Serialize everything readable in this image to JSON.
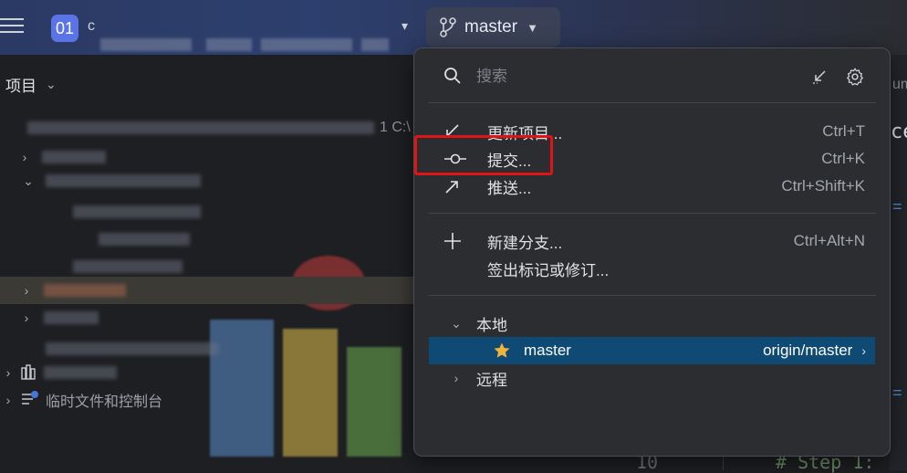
{
  "topbar": {
    "project_badge": "01",
    "project_name": "c",
    "branch_label": "master"
  },
  "project_panel": {
    "title": "项目",
    "path_suffix": "1 C:\\",
    "last_item": "临时文件和控制台"
  },
  "editor": {
    "line_number": "10",
    "code": "# Step 1:",
    "fragment_right_1": "ce",
    "fragment_right_2": "um"
  },
  "popup": {
    "search": {
      "placeholder": "搜索"
    },
    "actions": [
      {
        "label": "更新项目...",
        "shortcut": "Ctrl+T",
        "icon": "update-arrow-icon"
      },
      {
        "label": "提交...",
        "shortcut": "Ctrl+K",
        "icon": "commit-icon"
      },
      {
        "label": "推送...",
        "shortcut": "Ctrl+Shift+K",
        "icon": "push-arrow-icon"
      },
      {
        "label": "新建分支...",
        "shortcut": "Ctrl+Alt+N",
        "icon": "plus-icon"
      },
      {
        "label": "签出标记或修订...",
        "shortcut": "",
        "icon": ""
      }
    ],
    "groups": {
      "local": {
        "label": "本地",
        "branches": [
          {
            "name": "master",
            "tracking": "origin/master",
            "favorite": true
          }
        ]
      },
      "remote": {
        "label": "远程"
      }
    }
  },
  "colors": {
    "accent": "#0f4a74",
    "highlight_box": "#e01414",
    "star": "#f0b43c",
    "project_badge": "#5a74e6"
  }
}
